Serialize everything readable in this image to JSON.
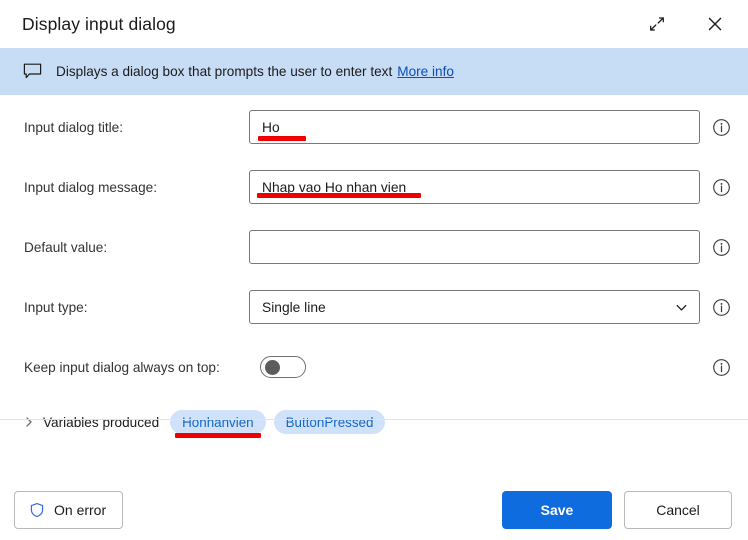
{
  "window": {
    "title": "Display input dialog",
    "expand_icon": "expand-diagonal-icon",
    "close_icon": "close-icon"
  },
  "banner": {
    "icon": "speech-bubble-icon",
    "text": "Displays a dialog box that prompts the user to enter text",
    "link_label": "More info"
  },
  "form": {
    "rows": [
      {
        "label": "Input dialog title:",
        "type": "text",
        "value": "Ho",
        "placeholder": "",
        "info_icon": "info-icon"
      },
      {
        "label": "Input dialog message:",
        "type": "text",
        "value": "Nhap vao Ho nhan vien",
        "placeholder": "",
        "info_icon": "info-icon"
      },
      {
        "label": "Default value:",
        "type": "text",
        "value": "",
        "placeholder": "",
        "info_icon": "info-icon"
      },
      {
        "label": "Input type:",
        "type": "select",
        "value": "Single line",
        "chevron_icon": "chevron-down-icon",
        "info_icon": "info-icon"
      },
      {
        "label": "Keep input dialog always on top:",
        "type": "toggle",
        "value": "off",
        "info_icon": "info-icon"
      }
    ]
  },
  "variables": {
    "chevron_icon": "chevron-right-icon",
    "label": "Variables produced",
    "pills": [
      {
        "name": "Honhanvien"
      },
      {
        "name": "ButtonPressed"
      }
    ]
  },
  "footer": {
    "on_error_label": "On error",
    "on_error_icon": "shield-icon",
    "save_label": "Save",
    "cancel_label": "Cancel"
  },
  "colors": {
    "banner_bg": "#c7dcf5",
    "link": "#0b4fb4",
    "primary": "#0f6cde",
    "pill_bg": "#cfe2fa",
    "pill_text": "#1767c9",
    "annotation_red": "#f20000"
  }
}
